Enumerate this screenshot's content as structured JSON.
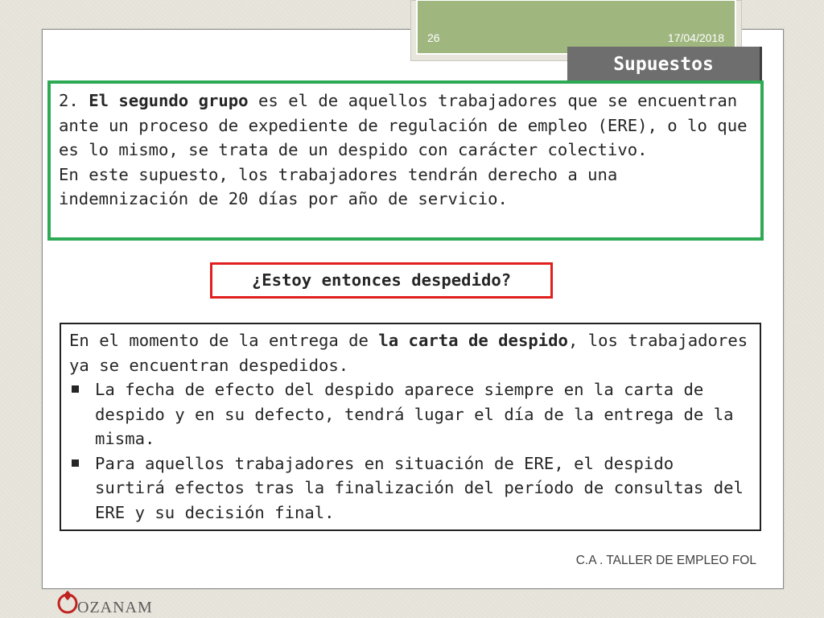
{
  "header": {
    "slide_number": "26",
    "date": "17/04/2018",
    "title": "Supuestos"
  },
  "green_box": {
    "prefix": "2. ",
    "bold": "El segundo grupo",
    "rest": " es el de aquellos trabajadores que se encuentran ante un proceso de expediente de regulación de empleo (ERE), o lo que es lo mismo, se trata de un despido con carácter colectivo.",
    "line2": "En este supuesto, los trabajadores tendrán derecho a una indemnización de 20 días por año de servicio."
  },
  "question": "¿Estoy entonces despedido?",
  "black_box": {
    "intro_prefix": "En el momento de la entrega de ",
    "intro_bold": "la carta de despido",
    "intro_suffix": ", los trabajadores ya se encuentran despedidos.",
    "bullets": [
      "La fecha de efecto del despido aparece siempre en la carta de despido y en su defecto, tendrá lugar el día de la entrega de la misma.",
      "Para aquellos trabajadores en situación de ERE, el despido surtirá efectos tras la finalización del período de consultas del ERE y su decisión final."
    ]
  },
  "footer": "C.A . TALLER DE EMPLEO FOL",
  "logo": {
    "word": "OZANAM",
    "colors": {
      "mark": "#c0231f",
      "text": "#5a5a5a"
    }
  },
  "colors": {
    "header_green": "#9fb67f",
    "title_tab": "#6e6e6e",
    "green_border": "#2eaa55",
    "red_border": "#e0201e"
  }
}
